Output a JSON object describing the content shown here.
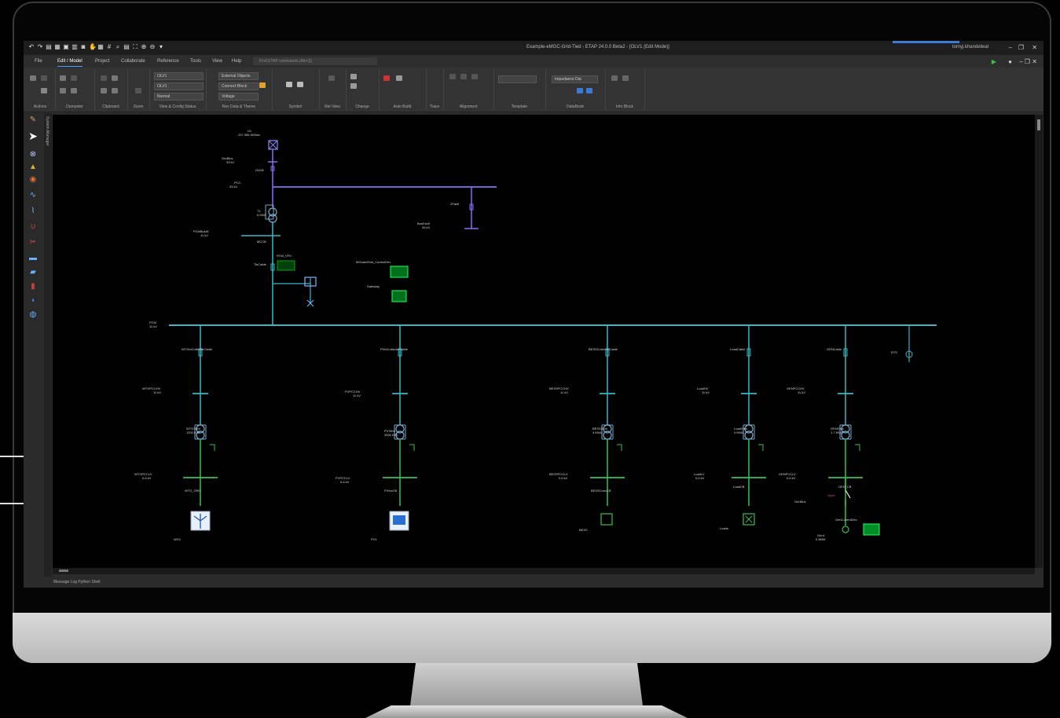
{
  "window": {
    "title": "Example-eMGC-Grid-Tied - ETAP 24.0.0 Beta2 - [OLV1 (Edit Mode)]",
    "user": "tomyj.khandelwal"
  },
  "menu_tabs": [
    "File",
    "Edit / Model",
    "Project",
    "Collaborate",
    "Reference",
    "Tools",
    "View",
    "Help"
  ],
  "search_placeholder": "Find ETAP commands (Alt+Q)",
  "ribbon": {
    "groups": [
      "Actions",
      "Dumpster",
      "Clipboard",
      "Zoom",
      "View & Config Status",
      "Rev Data & Theme",
      "Symbol",
      "Net View",
      "Change",
      "Auto Build",
      "Trace",
      "Alignment",
      "Template",
      "DataBook",
      "Info Block"
    ],
    "config_values": [
      "OLV1",
      "OLV1",
      "Normal",
      "External Objects",
      "Connect Block",
      "Voltage"
    ],
    "impedance_label": "Impedance Dia"
  },
  "side_panel_label": "System Manager",
  "status_tabs": "Message Log   Python Shell",
  "diagram": {
    "utility": {
      "name": "U1",
      "rating": "207.356 MVAsc"
    },
    "grid_bus": {
      "name": "GridBus",
      "kv": "33 kV"
    },
    "breaker_ga": "GA1B",
    "pcc_bus": {
      "name": "PCC",
      "kv": "33 kV"
    },
    "transformer_t1": {
      "name": "T1",
      "rating": "6 MVA"
    },
    "fault_bus": {
      "name": "BusFault",
      "kv": "33 kV"
    },
    "fault_label": "ZFault",
    "pcm_bus_main": {
      "name": "PCMBusW",
      "kv": "11 kV"
    },
    "breaker_mccb": "MCCB",
    "tie_cable": "TieCable",
    "pcm_vfd": "PCM_VFD",
    "controller": "MGuardGrid_ControlDev",
    "gateway": "Gateway",
    "main_bus": {
      "name": "PCM",
      "kv": "11 kV"
    },
    "rts": "RTS",
    "feeders": [
      {
        "cable": "WTGtoCollectorCable",
        "bus": "WTGPCCHV",
        "bus_kv": "11 kV",
        "xfmr": "WTGXfrm",
        "xfmr_rating": "1200 kVA",
        "lv_bus": "WTGPCCLV",
        "lv_kv": "0.6 kV",
        "breaker": "WTG_GRD",
        "device": "WG1"
      },
      {
        "cable": "PVtoCollectorCable",
        "bus": "PVPCCHV",
        "bus_kv": "11 kV",
        "xfmr": "PVXfrm",
        "xfmr_rating": "3000 kVA",
        "lv_bus": "PVPCCLV",
        "lv_kv": "0.6 kV",
        "breaker": "PVInvCB",
        "device": "PV1"
      },
      {
        "cable": "BESSCollectorCable",
        "bus": "BESSPCCHV",
        "bus_kv": "11 kV",
        "xfmr": "BESSXfrm",
        "xfmr_rating": "4 MVA",
        "lv_bus": "BESSPCCLV",
        "lv_kv": "0.6 kV",
        "breaker": "BESSConvCB",
        "device": "BESS"
      },
      {
        "cable": "LoadCable",
        "bus": "LoadHV",
        "bus_kv": "11 kV",
        "xfmr": "LoadXfrm",
        "xfmr_rating": "4 MVA",
        "lv_bus": "LoadLV",
        "lv_kv": "0.6 kV",
        "breaker": "LoadCB",
        "device": "Loads"
      },
      {
        "cable": "GENCable",
        "bus": "GENPCCHV",
        "bus_kv": "11 kV",
        "xfmr": "GENXfrm",
        "xfmr_rating": "1.7 MVA",
        "lv_bus": "GENPCCLV",
        "lv_kv": "0.6 kV",
        "breaker": "GEN_CB",
        "device": "Gen1",
        "device_rating": "0.5MW",
        "gen_bus": "GenBus",
        "controller": "GenControlDev",
        "open_label": "Open"
      }
    ]
  },
  "colors": {
    "accent": "#4aa3ff",
    "bus_teal": "#3ab7c4",
    "bus_violet": "#8a6cf0",
    "lv_green": "#37c24a",
    "device_green": "#2bd24b"
  }
}
